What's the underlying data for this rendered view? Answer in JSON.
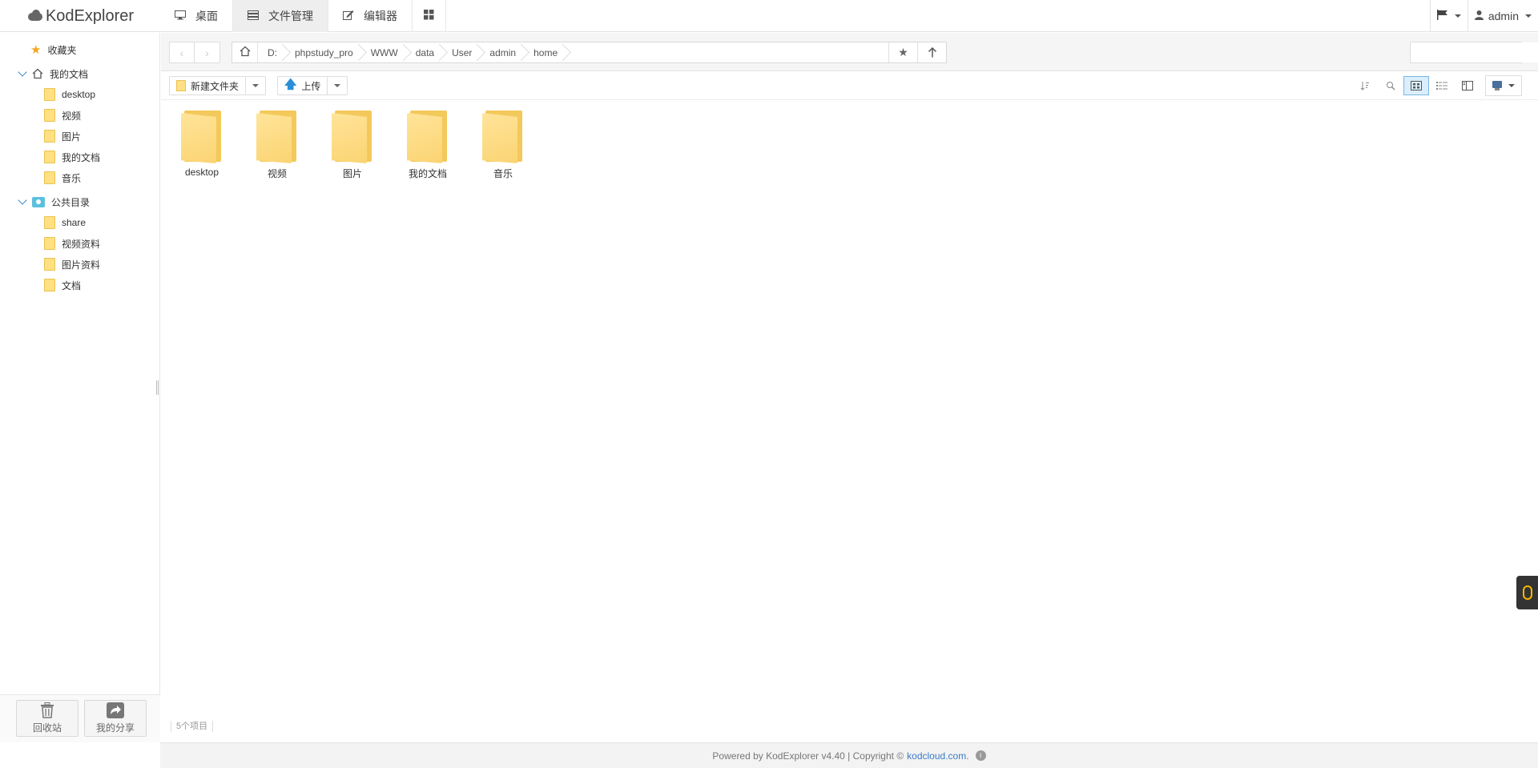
{
  "app": {
    "logo": "KodExplorer"
  },
  "nav": {
    "desktop": "桌面",
    "files": "文件管理",
    "editor": "编辑器"
  },
  "user": {
    "name": "admin"
  },
  "sidebar": {
    "favorites": "收藏夹",
    "my_docs": {
      "label": "我的文档",
      "children": [
        "desktop",
        "视频",
        "图片",
        "我的文档",
        "音乐"
      ]
    },
    "public": {
      "label": "公共目录",
      "children": [
        "share",
        "视频资料",
        "图片资料",
        "文档"
      ]
    },
    "recycle": "回收站",
    "my_share": "我的分享"
  },
  "path": {
    "crumbs": [
      "D:",
      "phpstudy_pro",
      "WWW",
      "data",
      "User",
      "admin",
      "home"
    ]
  },
  "toolbar": {
    "new_folder": "新建文件夹",
    "upload": "上传"
  },
  "files": [
    "desktop",
    "视频",
    "图片",
    "我的文档",
    "音乐"
  ],
  "status": "5个项目",
  "footer": {
    "text": "Powered by KodExplorer v4.40 | Copyright ©",
    "link": "kodcloud.com",
    "suffix": "."
  },
  "colors": {
    "folder": "#ffe083",
    "accent": "#3a87c8"
  }
}
